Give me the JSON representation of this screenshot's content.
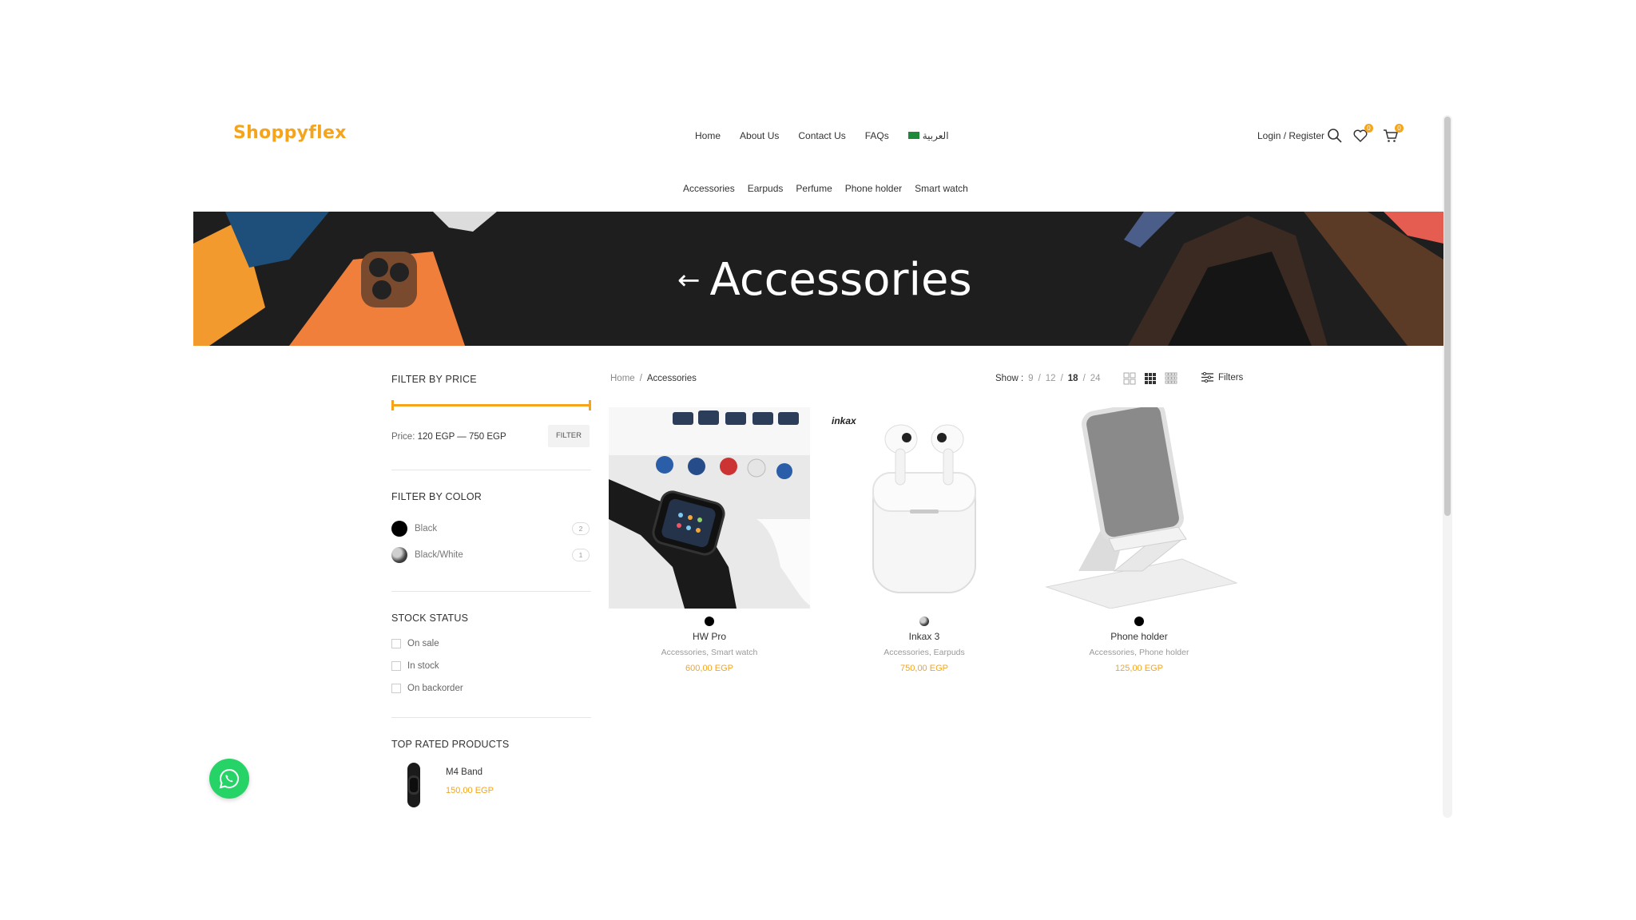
{
  "header": {
    "logo_text": "Shoppyflex",
    "nav": [
      "Home",
      "About Us",
      "Contact Us",
      "FAQs"
    ],
    "language_label": "العربية",
    "login_label": "Login / Register",
    "wishlist_count": "0",
    "cart_count": "0"
  },
  "categories_nav": [
    "Accessories",
    "Earpuds",
    "Perfume",
    "Phone holder",
    "Smart watch"
  ],
  "hero": {
    "arrow": "←",
    "title": "Accessories"
  },
  "sidebar": {
    "price": {
      "title": "FILTER BY PRICE",
      "label": "Price:",
      "range": "120 EGP — 750 EGP",
      "button": "FILTER"
    },
    "color": {
      "title": "FILTER BY COLOR",
      "items": [
        {
          "name": "Black",
          "count": "2"
        },
        {
          "name": "Black/White",
          "count": "1"
        }
      ]
    },
    "stock": {
      "title": "STOCK STATUS",
      "items": [
        "On sale",
        "In stock",
        "On backorder"
      ]
    },
    "top_rated": {
      "title": "TOP RATED PRODUCTS",
      "items": [
        {
          "name": "M4 Band",
          "price": "150,00 EGP"
        }
      ]
    }
  },
  "toolbar": {
    "breadcrumb": [
      "Home",
      "Accessories"
    ],
    "breadcrumb_sep": "/",
    "show_label": "Show :",
    "show_options": [
      "9",
      "12",
      "18",
      "24"
    ],
    "show_active": "18",
    "filters_label": "Filters"
  },
  "products": [
    {
      "name": "HW Pro",
      "categories": "Accessories, Smart watch",
      "price": "600,00 EGP"
    },
    {
      "name": "Inkax 3",
      "categories": "Accessories, Earpuds",
      "price": "750,00 EGP",
      "brand_mark": "inkax"
    },
    {
      "name": "Phone holder",
      "categories": "Accessories, Phone holder",
      "price": "125,00 EGP"
    }
  ],
  "colors": {
    "accent": "#f4a51c",
    "hero_bg": "#1e1e1e",
    "whatsapp": "#25d366"
  }
}
